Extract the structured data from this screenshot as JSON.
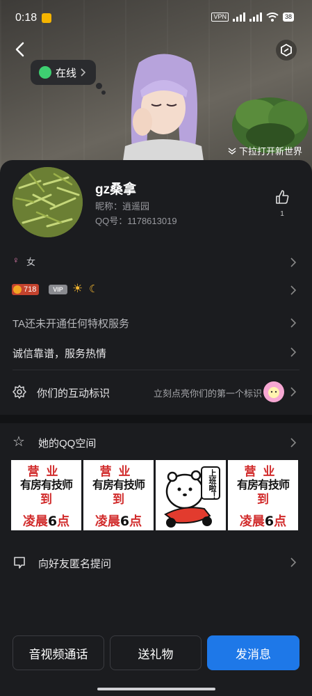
{
  "status_bar": {
    "time": "0:18",
    "vpn": "VPN",
    "battery": "38"
  },
  "hero": {
    "online_status": "在线",
    "pull_hint": "下拉打开新世界"
  },
  "profile": {
    "nickname": "gz桑拿",
    "alias_label": "昵称：逍遥园",
    "qq_label": "QQ号：1178613019",
    "like_count": "1"
  },
  "info": {
    "gender_symbol": "♀",
    "gender": "女",
    "level": "718",
    "vip": "VIP",
    "privilege": "TA还未开通任何特权服务",
    "signature": "诚信靠谱，服务热情"
  },
  "interaction": {
    "label": "你们的互动标识",
    "hint": "立刻点亮你们的第一个标识"
  },
  "qzone": {
    "label": "她的QQ空间",
    "thumbs": [
      {
        "top": "营业",
        "mid": "有房有技师",
        "mid2": "到",
        "bot_a": "凌晨",
        "bot_num": "6",
        "bot_b": "点"
      },
      {
        "top": "营业",
        "mid": "有房有技师",
        "mid2": "到",
        "bot_a": "凌晨",
        "bot_num": "6",
        "bot_b": "点"
      },
      {
        "top": "上班啦！"
      },
      {
        "top": "营业",
        "mid": "有房有技师",
        "mid2": "到",
        "bot_a": "凌晨",
        "bot_num": "6",
        "bot_b": "点"
      }
    ]
  },
  "ask": {
    "label": "向好友匿名提问"
  },
  "actions": {
    "call": "音视频通话",
    "gift": "送礼物",
    "message": "发消息"
  },
  "colors": {
    "primary": "#1e78e8",
    "online": "#3ecf71",
    "background": "#1b1c1f"
  }
}
